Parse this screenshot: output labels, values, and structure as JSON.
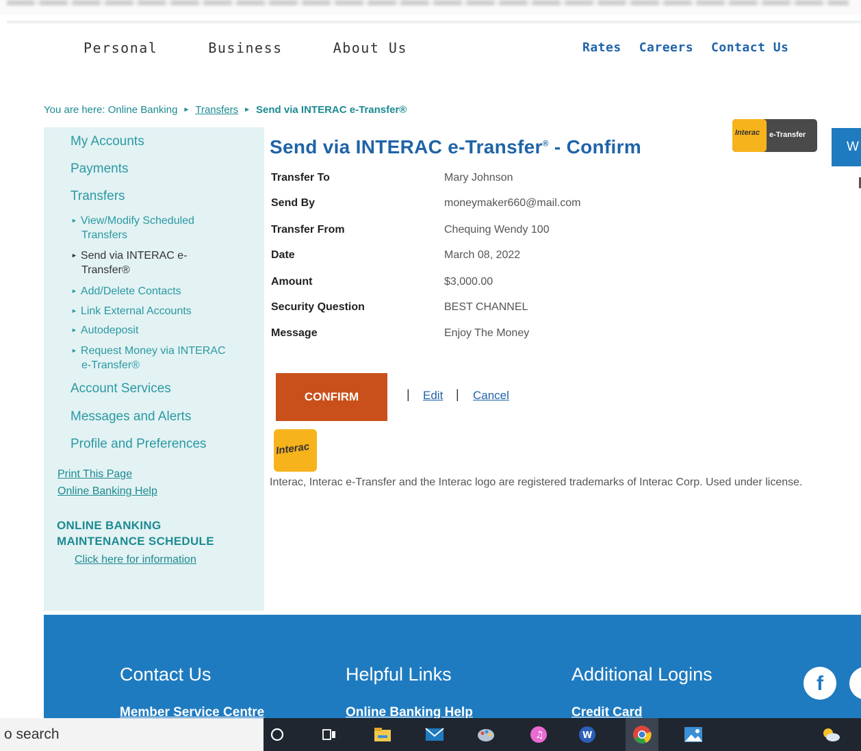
{
  "nav": {
    "left": [
      "Personal",
      "Business",
      "About Us"
    ],
    "right": [
      "Rates",
      "Careers",
      "Contact Us"
    ]
  },
  "breadcrumb": {
    "prefix": "You are here:",
    "items": [
      "Online Banking",
      "Transfers",
      "Send via INTERAC e-Transfer®"
    ]
  },
  "sidebar": {
    "main_top": [
      "My Accounts",
      "Payments",
      "Transfers"
    ],
    "sub_items": [
      {
        "line1": "View/Modify Scheduled",
        "line2": "Transfers"
      },
      {
        "line1": "Send via INTERAC e-",
        "line2": "Transfer®"
      },
      {
        "line1": "Add/Delete Contacts",
        "line2": ""
      },
      {
        "line1": "Link External Accounts",
        "line2": ""
      },
      {
        "line1": "Autodeposit",
        "line2": ""
      },
      {
        "line1": "Request Money via INTERAC",
        "line2": "e-Transfer®"
      }
    ],
    "main_bottom": [
      "Account Services",
      "Messages and Alerts",
      "Profile and Preferences"
    ],
    "print_page": "Print This Page",
    "help": "Online Banking Help",
    "maint_line1": "ONLINE BANKING",
    "maint_line2": "MAINTENANCE SCHEDULE",
    "maint_link": "Click here for information"
  },
  "main": {
    "title": "Send via INTERAC e-Transfer",
    "title_sup": "®",
    "title_suffix": " - Confirm",
    "details": [
      {
        "label": "Transfer To",
        "value": "Mary Johnson"
      },
      {
        "label": "Send By",
        "value": "moneymaker660@mail.com"
      },
      {
        "label": "Transfer From",
        "value": "Chequing Wendy 100"
      },
      {
        "label": "Date",
        "value": "March 08, 2022"
      },
      {
        "label": "Amount",
        "value": "$3,000.00"
      },
      {
        "label": "Security Question",
        "value": "BEST CHANNEL"
      },
      {
        "label": "Message",
        "value": "Enjoy The Money"
      }
    ],
    "confirm_label": "CONFIRM",
    "edit_label": "Edit",
    "cancel_label": "Cancel",
    "trademark": "Interac, Interac e-Transfer and the Interac logo are registered trademarks of Interac Corp. Used under license.",
    "logo_text": "Interac",
    "badge_brand": "Interac",
    "badge_label": "e-Transfer",
    "side_button_letter": "W"
  },
  "footer": {
    "contact_heading": "Contact Us",
    "contact_link": "Member Service Centre",
    "helpful_heading": "Helpful Links",
    "helpful_link": "Online Banking Help",
    "logins_heading": "Additional Logins",
    "logins_link": "Credit Card",
    "social_letter": "f"
  },
  "taskbar": {
    "search_text": "o search",
    "icons": [
      "cortana-icon",
      "task-view-icon",
      "file-explorer-icon",
      "mail-icon",
      "paint-icon",
      "itunes-icon",
      "word-icon",
      "chrome-icon",
      "photos-icon",
      "weather-icon"
    ]
  },
  "colors": {
    "brand_blue": "#1f63a8",
    "teal": "#1c8a92",
    "confirm_orange": "#c9501a",
    "footer_blue": "#1f7bc0",
    "sidebar_bg": "#e3f2f3",
    "interac_yellow": "#f6b31c"
  }
}
